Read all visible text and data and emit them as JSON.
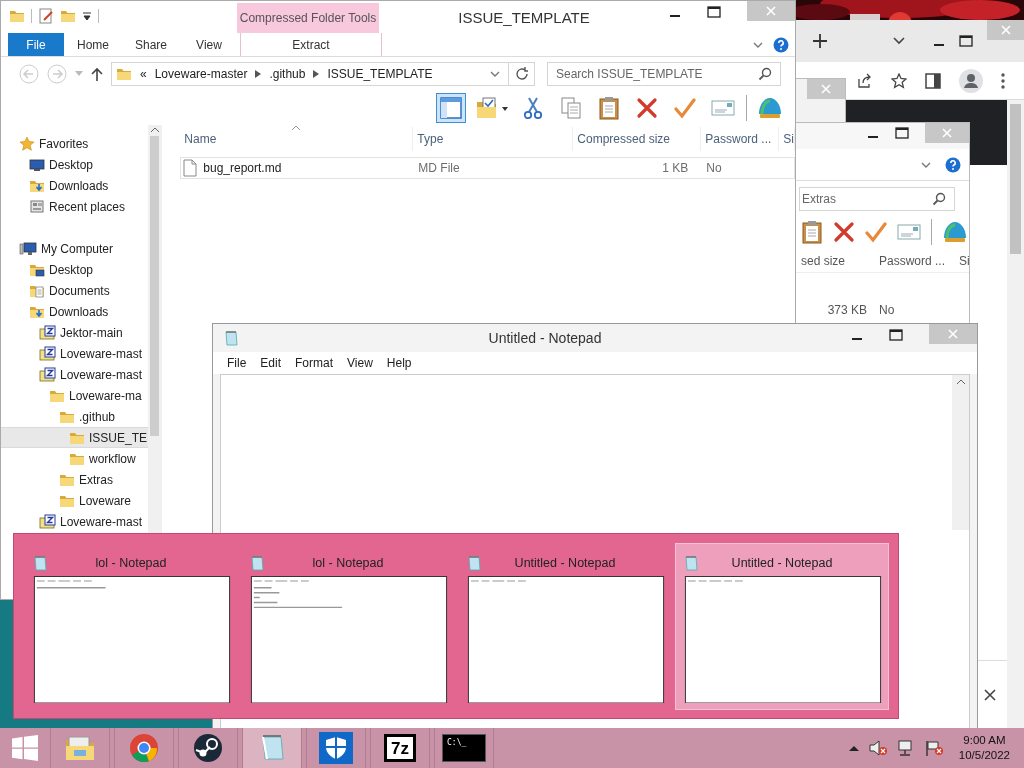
{
  "back_window": {
    "search": {
      "placeholder": "Extras"
    },
    "columns": [
      "sed size",
      "Password ...",
      "Si"
    ],
    "row": [
      "373 KB",
      "No"
    ]
  },
  "explorer": {
    "title": "ISSUE_TEMPLATE",
    "context_group": "Compressed Folder Tools",
    "ribbon_tabs": [
      {
        "label": "File",
        "kind": "file"
      },
      {
        "label": "Home",
        "kind": "tab"
      },
      {
        "label": "Share",
        "kind": "tab"
      },
      {
        "label": "View",
        "kind": "tab"
      },
      {
        "label": "Extract",
        "kind": "context"
      }
    ],
    "breadcrumbs": [
      "«",
      "Loveware-master",
      ".github",
      "ISSUE_TEMPLATE"
    ],
    "search": {
      "placeholder": "Search ISSUE_TEMPLATE"
    },
    "toolbar": [
      {
        "kind": "preview-pane",
        "selected": true
      },
      {
        "kind": "folder-check",
        "selected": false
      },
      {
        "kind": "scissors",
        "selected": false
      },
      {
        "kind": "copy",
        "selected": false
      },
      {
        "kind": "paste",
        "selected": false
      },
      {
        "kind": "delete",
        "selected": false
      },
      {
        "kind": "check",
        "selected": false
      },
      {
        "kind": "envelope",
        "selected": false
      },
      {
        "kind": "shell",
        "selected": false
      }
    ],
    "nav": [
      {
        "label": "Favorites",
        "kind": "star",
        "selected": false,
        "children": [
          {
            "label": "Desktop",
            "kind": "desktop",
            "selected": false
          },
          {
            "label": "Downloads",
            "kind": "downloads",
            "selected": false
          },
          {
            "label": "Recent places",
            "kind": "recent",
            "selected": false
          }
        ]
      },
      {
        "label": "My Computer",
        "kind": "computer",
        "selected": false,
        "children": [
          {
            "label": "Desktop",
            "kind": "desktop-folder",
            "selected": false
          },
          {
            "label": "Documents",
            "kind": "documents",
            "selected": false
          },
          {
            "label": "Downloads",
            "kind": "downloads",
            "selected": false,
            "children": [
              {
                "label": "Jektor-main",
                "kind": "zip",
                "selected": false
              },
              {
                "label": "Loveware-mast",
                "kind": "zip",
                "selected": false
              },
              {
                "label": "Loveware-mast",
                "kind": "zip",
                "selected": false,
                "children": [
                  {
                    "label": "Loveware-ma",
                    "kind": "folder",
                    "selected": false,
                    "children": [
                      {
                        "label": ".github",
                        "kind": "folder",
                        "selected": false,
                        "children": [
                          {
                            "label": "ISSUE_TE",
                            "kind": "folder",
                            "selected": true
                          },
                          {
                            "label": "workflow",
                            "kind": "folder",
                            "selected": false
                          }
                        ]
                      },
                      {
                        "label": "Extras",
                        "kind": "folder",
                        "selected": false
                      },
                      {
                        "label": "Loveware",
                        "kind": "folder",
                        "selected": false
                      }
                    ]
                  }
                ]
              },
              {
                "label": "Loveware-mast",
                "kind": "zip",
                "selected": false
              }
            ]
          }
        ]
      }
    ],
    "columns": [
      {
        "label": "Name",
        "sorted": true
      },
      {
        "label": "Type",
        "sorted": false
      },
      {
        "label": "Compressed size",
        "sorted": false
      },
      {
        "label": "Password ...",
        "sorted": false
      },
      {
        "label": "Si",
        "sorted": false
      }
    ],
    "files": [
      {
        "name": "bug_report.md",
        "type": "MD File",
        "compressed_size": "1 KB",
        "password": "No"
      }
    ]
  },
  "notepad": {
    "title": "Untitled - Notepad",
    "menu": [
      "File",
      "Edit",
      "Format",
      "View",
      "Help"
    ]
  },
  "thumbnails": [
    {
      "title": "lol - Notepad",
      "kind": "text",
      "selected": false
    },
    {
      "title": "lol - Notepad",
      "kind": "text",
      "selected": false
    },
    {
      "title": "Untitled - Notepad",
      "kind": "blank",
      "selected": false
    },
    {
      "title": "Untitled - Notepad",
      "kind": "blank",
      "selected": true
    }
  ],
  "taskbar": {
    "apps": [
      {
        "kind": "explorer",
        "selected": false
      },
      {
        "kind": "chrome",
        "selected": false
      },
      {
        "kind": "steam",
        "selected": false
      },
      {
        "kind": "notepad",
        "selected": true
      },
      {
        "kind": "shield",
        "selected": false
      },
      {
        "kind": "sevenzip",
        "label": "7z",
        "selected": false
      },
      {
        "kind": "console",
        "label": "C:\\_",
        "selected": false
      }
    ],
    "time": "9:00 AM",
    "date": "10/5/2022"
  }
}
